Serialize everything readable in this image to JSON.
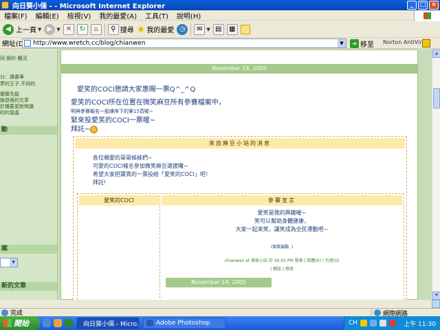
{
  "window": {
    "title": "向日葵小倆 - - Microsoft Internet Explorer",
    "controls": [
      "_",
      "□",
      "×"
    ]
  },
  "menu": [
    "檔案(F)",
    "編輯(E)",
    "檢視(V)",
    "我的最愛(A)",
    "工具(T)",
    "說明(H)"
  ],
  "toolbar": {
    "back": "上一頁",
    "search": "搜尋",
    "favorites": "我的最愛"
  },
  "address": {
    "label": "網址(D)",
    "url": "http://www.wretch.cc/blog/chianwen",
    "go": "移至",
    "norton": "Norton AntiVirus"
  },
  "sidebar": {
    "lines": [
      "同 摘抄-醫況",
      "分：讀書筆",
      "夢的王子,不同的",
      "擺實先能",
      "錄發表的文章",
      "於機要更新時讀",
      "的的當處"
    ],
    "heads": [
      "動",
      "案",
      "新的文章"
    ]
  },
  "post": {
    "date": "November 14, 2005",
    "title": "愛笑的COCI懇請大家惠賜一票Q^_^Q",
    "line1": "愛笑的COCI所在位置在微笑麻豆所有參賽檔案中，",
    "line2": "明與參賽報名一般練序下的第15頁喔~",
    "line3": "緊來投愛笑的COCI一票喔~",
    "line4": "拜託~"
  },
  "message": {
    "header": "來自麻豆小站的消息",
    "lines": [
      "各位親愛的哥哥姊姊們~",
      "可愛的COCI報名參加微笑麻豆選拔囉~",
      "希望大家把寶貴的一票投給「愛笑的COCI」吧！",
      "拜託!"
    ],
    "col1": "愛笑的COCI",
    "col2": "參賽宣言",
    "manifesto": [
      "愛笑是我的興趣喔~",
      "笑可以幫助身體健康，",
      "大家一起來笑，讓笑成為全民運動吧~"
    ],
    "signature": "(微笑鼓勵 .)",
    "meta": "chianwen at 瀏各小站 於 06:01 PM 發表 | 回應(0) | 引用(0)",
    "meta2": "| 網誌 | 修改",
    "date2": "November 14, 2005"
  },
  "status": {
    "text": "完成",
    "zone": "網際網路"
  },
  "taskbar": {
    "start": "開始",
    "tasks": [
      "向日葵小倆 - Micro...",
      "Adobe Photoshop"
    ],
    "lang": "CH",
    "clock": "上午 11:30"
  }
}
